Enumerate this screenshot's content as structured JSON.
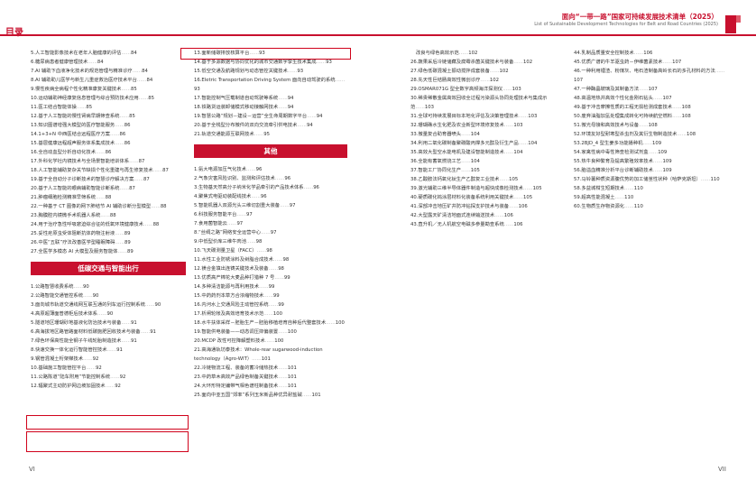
{
  "header": {
    "toc_label": "目录",
    "title": "面向“一带一路”国家可持续发展技术清单（2025）",
    "subtitle": "List of Sustainable Development Technologies for Belt and Road Countries (2025)"
  },
  "page_left": "VI",
  "page_right": "VII",
  "col1": [
    {
      "t": "5.人工智能影像技术在老年人脑健康的评估",
      "p": "84"
    },
    {
      "t": "6.糖尿病患者健康管理技术",
      "p": "84"
    },
    {
      "t": "7.AI 辅助下血液净化技术的规范管理与精准诊疗",
      "p": "84"
    },
    {
      "t": "8.AI 辅助助儿医学与新生儿重症救治医疗技术平台",
      "p": "84"
    },
    {
      "t": "9.慢性疾病全病程个性化精准康复关键技术",
      "p": "85"
    },
    {
      "t": "10.运动辅助神经康复信息管理与综合预防技术应用",
      "p": "85"
    },
    {
      "t": "11.医工结合智能体操",
      "p": "85"
    },
    {
      "t": "12.基于人工智能的慢性肾病早期筛查系统",
      "p": "85"
    },
    {
      "t": "13.知识图谱增强大模型的医疗智能服务",
      "p": "86"
    },
    {
      "t": "14.1+3+N 中西医结合远程医疗方案",
      "p": "86"
    },
    {
      "t": "15.基层健康远程超声服务体系集成技术",
      "p": "86"
    },
    {
      "t": "16.全自动血型分析自动化技术",
      "p": "86"
    },
    {
      "t": "17.外科化学社内镜技术与全场景智能培训体系",
      "p": "87"
    },
    {
      "t": "18.人工智能辅助复杂关节缺损个性化重建与再生修复技术",
      "p": "87",
      "wrap": true
    },
    {
      "t": "19.基于全自动分子诊断技术的智慧诊疗解决方案",
      "p": "87"
    },
    {
      "t": "20.基于人工智能的眼病辅助智能诊断系统",
      "p": "87"
    },
    {
      "t": "21.肿瘤细胞检测精准早筛系统",
      "p": "88"
    },
    {
      "t": "22.一种基于 CT 图像的网下肺结节 AI 辅助诊断分型模型",
      "p": "88",
      "wrap": true
    },
    {
      "t": "23.胸膜腔内镜微手术机器人系统",
      "p": "88"
    },
    {
      "t": "24.用于治疗急性呼吸窘迫综合征的低氧环境健康技术",
      "p": "88",
      "wrap": true
    },
    {
      "t": "25.妥性疟原虫受体阻断抗体药物注射液",
      "p": "89"
    },
    {
      "t": "26.中医“五联”疗法改善医学型睡眠障碍",
      "p": "89"
    },
    {
      "t": "27.全医学多模态 AI 大模型及服务智能体",
      "p": "89"
    }
  ],
  "col1_section": "低碳交通与智能出行",
  "col1b": [
    {
      "t": "1.公路智慧收费系统",
      "p": "90"
    },
    {
      "t": "2.公路智能交通管控系统",
      "p": "90"
    },
    {
      "t": "3.面向城市轨道交通线网互联互通的列车运行控制系统",
      "p": "90",
      "wrap": true
    },
    {
      "t": "4.高原超薄面普德柜后技术体系",
      "p": "90"
    },
    {
      "t": "5.隧道地区珊瑚砂地基液化防治技术与装备",
      "p": "91"
    },
    {
      "t": "6.高海拔地区路管路面材料低碳施肥回收技术与装备",
      "p": "91"
    },
    {
      "t": "7.绿色环保高性能全钢子午线轮胎制造技术",
      "p": "91"
    },
    {
      "t": "8.快速交换一体化运行智能管控技术",
      "p": "91"
    },
    {
      "t": "9.钢管混凝土桁架梯技术",
      "p": "92"
    },
    {
      "t": "10.基础施工智能管控平台",
      "p": "92"
    },
    {
      "t": "11.公路陈道“陆车附用”节能控制系统",
      "p": "92"
    },
    {
      "t": "12.辐聚式主动防护网边坡加固技术",
      "p": "92"
    }
  ],
  "col2": [
    {
      "t": "13.面新储碳排放核算平台",
      "p": "93"
    },
    {
      "t": "14.基于多源数据与协同优化的城市交通数字孪生技术集成",
      "p": "93",
      "wrap": true
    },
    {
      "t": "15.低空交通及航路规划与动态管控关键技术",
      "p": "93"
    },
    {
      "t": "16.Eletric Transportation Driving System 面向自动驾驶的系统",
      "p": "93",
      "wrap": true
    },
    {
      "t": "17.智能控制气压载制道自动驾驶等系统",
      "p": "94"
    },
    {
      "t": "18.铁路货运装卸储模式移动接触网技术",
      "p": "94"
    },
    {
      "t": "19.智慧公路“规划－建设－运营”全生命周期数字平台",
      "p": "94",
      "wrap": true
    },
    {
      "t": "20.基于全栈型分布微件的双向交流牵引供电技术",
      "p": "94"
    },
    {
      "t": "21.轨道交通能源互联网技术",
      "p": "95"
    }
  ],
  "col2_section": "其他",
  "col2b": [
    {
      "t": "1.氨大电源加压气化技术",
      "p": "96"
    },
    {
      "t": "2.气象灾害风险识别、监测和评估技术",
      "p": "96"
    },
    {
      "t": "3.生物基天然高分子纳米化学品牵引的产品技术体系",
      "p": "96"
    },
    {
      "t": "4.聚焦式电驱动装配线技术",
      "p": "96"
    },
    {
      "t": "5.智能机器人双源光头三维切割重大装备",
      "p": "97"
    },
    {
      "t": "6.科技服务智能平台",
      "p": "97"
    },
    {
      "t": "7.食用菌智能云",
      "p": "97"
    },
    {
      "t": "8.“丝绸之路”网络安全运营中心",
      "p": "97"
    },
    {
      "t": "9.中低型价库三维牛肉池",
      "p": "98"
    },
    {
      "t": "10.飞天碳测量卫星（FACC）",
      "p": "98"
    },
    {
      "t": "11.水性工业防锈涂料及树脂合成技术",
      "p": "98"
    },
    {
      "t": "12.镁合金填出连铸关键技术及装备",
      "p": "98"
    },
    {
      "t": "13.优质高产棉花大麦品种打猎种 7 号",
      "p": "99"
    },
    {
      "t": "14.多种清洁能源与再利用技术",
      "p": "99"
    },
    {
      "t": "15.中药药剂本草方合浓缩物技术",
      "p": "99"
    },
    {
      "t": "16.内河水上交通风险主动管控系统",
      "p": "99"
    },
    {
      "t": "17.析闸轮帐及高效培育技术示范",
      "p": "100"
    },
    {
      "t": "18.水牛扶体采样－胚胎生产－胚胎移植培育自种后代整套技术",
      "p": "100",
      "wrap": true
    },
    {
      "t": "19.智能供电装备——动态调压抑偏装置",
      "p": "100"
    },
    {
      "t": "20.MCDP 改性可控降解塑料技术",
      "p": "100"
    },
    {
      "t": "21.高海通轨坊泰技术：Whole-rear sugarwood-induction technology（Agro-WIT）",
      "p": "101",
      "wrap": true
    },
    {
      "t": "22.冷链物流工程、装备的蓄冷储热技术",
      "p": "101"
    },
    {
      "t": "23.中药草木高效产品绿色制备关键技术",
      "p": "101"
    },
    {
      "t": "24.大环形特定编带气相色谱柱制备技术",
      "p": "101"
    },
    {
      "t": "25.面向中亚五国“郊率”系列玉米新品种优异耐盐碱",
      "p": "101"
    }
  ],
  "col3": [
    {
      "t": "改良与绿色高效示范",
      "p": "102",
      "indent": true
    },
    {
      "t": "26.蔬果采后冷链储藏及腐霉杀菌关键技术与装备",
      "p": "102"
    },
    {
      "t": "27.绿色低碳混凝土振动搅拌成套装备",
      "p": "102"
    },
    {
      "t": "28.先天性巨结肠高效性微创诊疗",
      "p": "102"
    },
    {
      "t": "29.OSMAR071G 型全数字高频海洋探测仪",
      "p": "103"
    },
    {
      "t": "30.稀贵稀散金属高效回收全过程污染源头协同处理技术与集成示范",
      "p": "103",
      "wrap": true
    },
    {
      "t": "31.全球可持续发展目标本地化评估及决策管理技术",
      "p": "103"
    },
    {
      "t": "32.珊瑚礁水生化肥及农业新型环境修复技术",
      "p": "103"
    },
    {
      "t": "33.微量复合助育器喷头",
      "p": "104"
    },
    {
      "t": "34.利用二氧化碳制备聚碳酸丙撑多元醇及衍生产品",
      "p": "104"
    },
    {
      "t": "35.高效大型空水能电机及建设智能制造技术",
      "p": "104"
    },
    {
      "t": "36.全能有蓄氧燃烧工艺",
      "p": "104"
    },
    {
      "t": "37.智能工厂协同化生产",
      "p": "105"
    },
    {
      "t": "38.乙酸胺法钙氧化钛生产乙醇复工业技术",
      "p": "105"
    },
    {
      "t": "39.激光辅助三维半导体器件制造与超快成像检测技术",
      "p": "105"
    },
    {
      "t": "40.硬质碳化钨涂层材料化装备系统利用关键技术",
      "p": "105"
    },
    {
      "t": "41.深部冲击地压矿井防冲钻探支护技术与装备",
      "p": "106"
    },
    {
      "t": "42.大型露天矿清洁地面式连续输送技术",
      "p": "106"
    },
    {
      "t": "43.直升机／无人机航空电磁多参量勘查系统",
      "p": "106"
    }
  ],
  "col4": [
    {
      "t": "44.乳制品质量安全控制技术",
      "p": "106"
    },
    {
      "t": "45.优质广谱的牛羊驱虫药－伊维菌素技术",
      "p": "107"
    },
    {
      "t": "46.一种利用锂渣、粉煤灰、电石渣制备高岭长石的多孔材料的方法",
      "p": "107",
      "wrap": true
    },
    {
      "t": "47.一种酶晶玻璃及其制备方法",
      "p": "107"
    },
    {
      "t": "48.高温地热并高效个性化金刚石钻头",
      "p": "107"
    },
    {
      "t": "49.基于冲击摩擦性质的工程无损检测成套技术",
      "p": "108"
    },
    {
      "t": "50.废弃油脂加氢处理集成转化可持续航空燃料",
      "p": "108"
    },
    {
      "t": "51.微光母接和高效技术与设备",
      "p": "108"
    },
    {
      "t": "52.环境友好型耐寒型杀虫剂及其衍生物制造技术",
      "p": "108"
    },
    {
      "t": "53.2BJD_4 型生姜多功能播种机",
      "p": "109"
    },
    {
      "t": "54.家禽性病中毒性筛查检测试剂盒",
      "p": "109"
    },
    {
      "t": "55.热牛良种繁育及提高繁殖效率技术",
      "p": "109"
    },
    {
      "t": "56.脑溢血精准分析平台诊断辅助技术",
      "p": "109"
    },
    {
      "t": "57.马铃薯种质资源腹优势的加工储茎性状种（哈萨克斯坦）",
      "p": "110",
      "wrap": true
    },
    {
      "t": "58.多益城柑生短期技术",
      "p": "110"
    },
    {
      "t": "59.超高性能混凝土",
      "p": "110"
    },
    {
      "t": "60.生物质生存物资源化",
      "p": "110"
    }
  ]
}
